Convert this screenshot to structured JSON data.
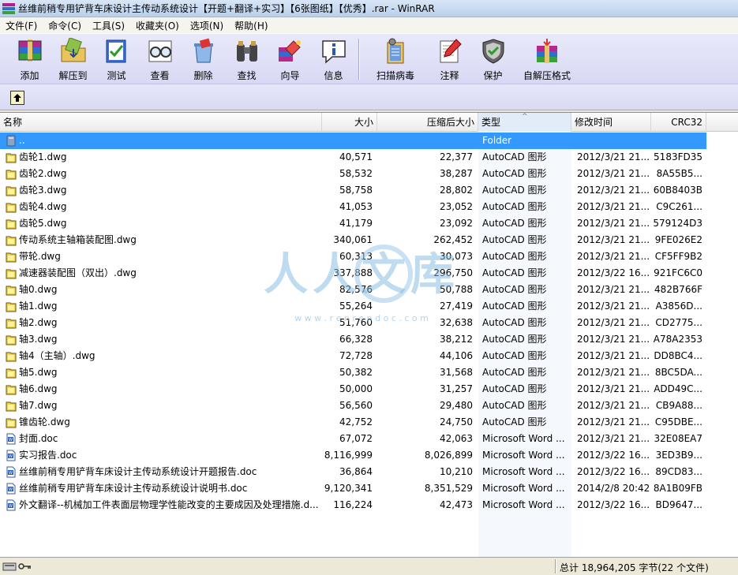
{
  "window": {
    "title": "丝维前稍专用铲背车床设计主传动系统设计【开题+翻译+实习】【6张图纸】【优秀】.rar - WinRAR"
  },
  "menu": [
    "文件(F)",
    "命令(C)",
    "工具(S)",
    "收藏夹(O)",
    "选项(N)",
    "帮助(H)"
  ],
  "toolbar": {
    "add": "添加",
    "extract": "解压到",
    "test": "测试",
    "view": "查看",
    "delete": "删除",
    "find": "查找",
    "wizard": "向导",
    "info": "信息",
    "virus": "扫描病毒",
    "comment": "注释",
    "protect": "保护",
    "sfx": "自解压格式"
  },
  "columns": {
    "name": "名称",
    "size": "大小",
    "packed": "压缩后大小",
    "type": "类型",
    "modified": "修改时间",
    "crc": "CRC32"
  },
  "rows": [
    {
      "name": "..",
      "size": "",
      "packed": "",
      "type": "Folder",
      "modified": "",
      "crc": "",
      "icon": "folder",
      "selected": true
    },
    {
      "name": "齿轮1.dwg",
      "size": "40,571",
      "packed": "22,377",
      "type": "AutoCAD 图形",
      "modified": "2012/3/21 21...",
      "crc": "5183FD35",
      "icon": "dwg"
    },
    {
      "name": "齿轮2.dwg",
      "size": "58,532",
      "packed": "38,287",
      "type": "AutoCAD 图形",
      "modified": "2012/3/21 21...",
      "crc": "8A55B5...",
      "icon": "dwg"
    },
    {
      "name": "齿轮3.dwg",
      "size": "58,758",
      "packed": "28,802",
      "type": "AutoCAD 图形",
      "modified": "2012/3/21 21...",
      "crc": "60B8403B",
      "icon": "dwg"
    },
    {
      "name": "齿轮4.dwg",
      "size": "41,053",
      "packed": "23,052",
      "type": "AutoCAD 图形",
      "modified": "2012/3/21 21...",
      "crc": "C9C261...",
      "icon": "dwg"
    },
    {
      "name": "齿轮5.dwg",
      "size": "41,179",
      "packed": "23,092",
      "type": "AutoCAD 图形",
      "modified": "2012/3/21 21...",
      "crc": "579124D3",
      "icon": "dwg"
    },
    {
      "name": "传动系统主轴箱装配图.dwg",
      "size": "340,061",
      "packed": "262,452",
      "type": "AutoCAD 图形",
      "modified": "2012/3/21 21...",
      "crc": "9FE026E2",
      "icon": "dwg"
    },
    {
      "name": "带轮.dwg",
      "size": "60,313",
      "packed": "30,073",
      "type": "AutoCAD 图形",
      "modified": "2012/3/21 21...",
      "crc": "CF5FF9B2",
      "icon": "dwg"
    },
    {
      "name": "减速器装配图（双出）.dwg",
      "size": "337,888",
      "packed": "296,750",
      "type": "AutoCAD 图形",
      "modified": "2012/3/22 16...",
      "crc": "921FC6C0",
      "icon": "dwg"
    },
    {
      "name": "轴0.dwg",
      "size": "82,576",
      "packed": "50,788",
      "type": "AutoCAD 图形",
      "modified": "2012/3/21 21...",
      "crc": "482B766F",
      "icon": "dwg"
    },
    {
      "name": "轴1.dwg",
      "size": "55,264",
      "packed": "27,419",
      "type": "AutoCAD 图形",
      "modified": "2012/3/21 21...",
      "crc": "A3856D...",
      "icon": "dwg"
    },
    {
      "name": "轴2.dwg",
      "size": "51,760",
      "packed": "32,638",
      "type": "AutoCAD 图形",
      "modified": "2012/3/21 21...",
      "crc": "CD2775...",
      "icon": "dwg"
    },
    {
      "name": "轴3.dwg",
      "size": "66,328",
      "packed": "38,212",
      "type": "AutoCAD 图形",
      "modified": "2012/3/21 21...",
      "crc": "A78A2353",
      "icon": "dwg"
    },
    {
      "name": "轴4（主轴）.dwg",
      "size": "72,728",
      "packed": "44,106",
      "type": "AutoCAD 图形",
      "modified": "2012/3/21 21...",
      "crc": "DD8BC4...",
      "icon": "dwg"
    },
    {
      "name": "轴5.dwg",
      "size": "50,382",
      "packed": "31,568",
      "type": "AutoCAD 图形",
      "modified": "2012/3/21 21...",
      "crc": "8BC5DA...",
      "icon": "dwg"
    },
    {
      "name": "轴6.dwg",
      "size": "50,000",
      "packed": "31,257",
      "type": "AutoCAD 图形",
      "modified": "2012/3/21 21...",
      "crc": "ADD49C...",
      "icon": "dwg"
    },
    {
      "name": "轴7.dwg",
      "size": "56,560",
      "packed": "29,480",
      "type": "AutoCAD 图形",
      "modified": "2012/3/21 21...",
      "crc": "CB9A88...",
      "icon": "dwg"
    },
    {
      "name": "锥齿轮.dwg",
      "size": "42,752",
      "packed": "24,750",
      "type": "AutoCAD 图形",
      "modified": "2012/3/21 21...",
      "crc": "C95DBE...",
      "icon": "dwg"
    },
    {
      "name": "封面.doc",
      "size": "67,072",
      "packed": "42,063",
      "type": "Microsoft Word ...",
      "modified": "2012/3/21 21...",
      "crc": "32E08EA7",
      "icon": "doc"
    },
    {
      "name": "实习报告.doc",
      "size": "8,116,999",
      "packed": "8,026,899",
      "type": "Microsoft Word ...",
      "modified": "2012/3/22 16...",
      "crc": "3ED3B9...",
      "icon": "doc"
    },
    {
      "name": "丝维前稍专用铲背车床设计主传动系统设计开题报告.doc",
      "size": "36,864",
      "packed": "10,210",
      "type": "Microsoft Word ...",
      "modified": "2012/3/22 16...",
      "crc": "89CD83...",
      "icon": "doc"
    },
    {
      "name": "丝维前稍专用铲背车床设计主传动系统设计说明书.doc",
      "size": "9,120,341",
      "packed": "8,351,529",
      "type": "Microsoft Word ...",
      "modified": "2014/2/8 20:42",
      "crc": "8A1B09FB",
      "icon": "doc"
    },
    {
      "name": "外文翻译--机械加工件表面层物理学性能改变的主要成因及处理措施.d...",
      "size": "116,224",
      "packed": "42,473",
      "type": "Microsoft Word ...",
      "modified": "2012/3/22 16...",
      "crc": "BD9647...",
      "icon": "doc"
    }
  ],
  "status": {
    "summary": "总计 18,964,205 字节(22 个文件)"
  },
  "watermark": {
    "text": "人人文库",
    "url": "w w w . r e n r e n d o c . c o m"
  }
}
